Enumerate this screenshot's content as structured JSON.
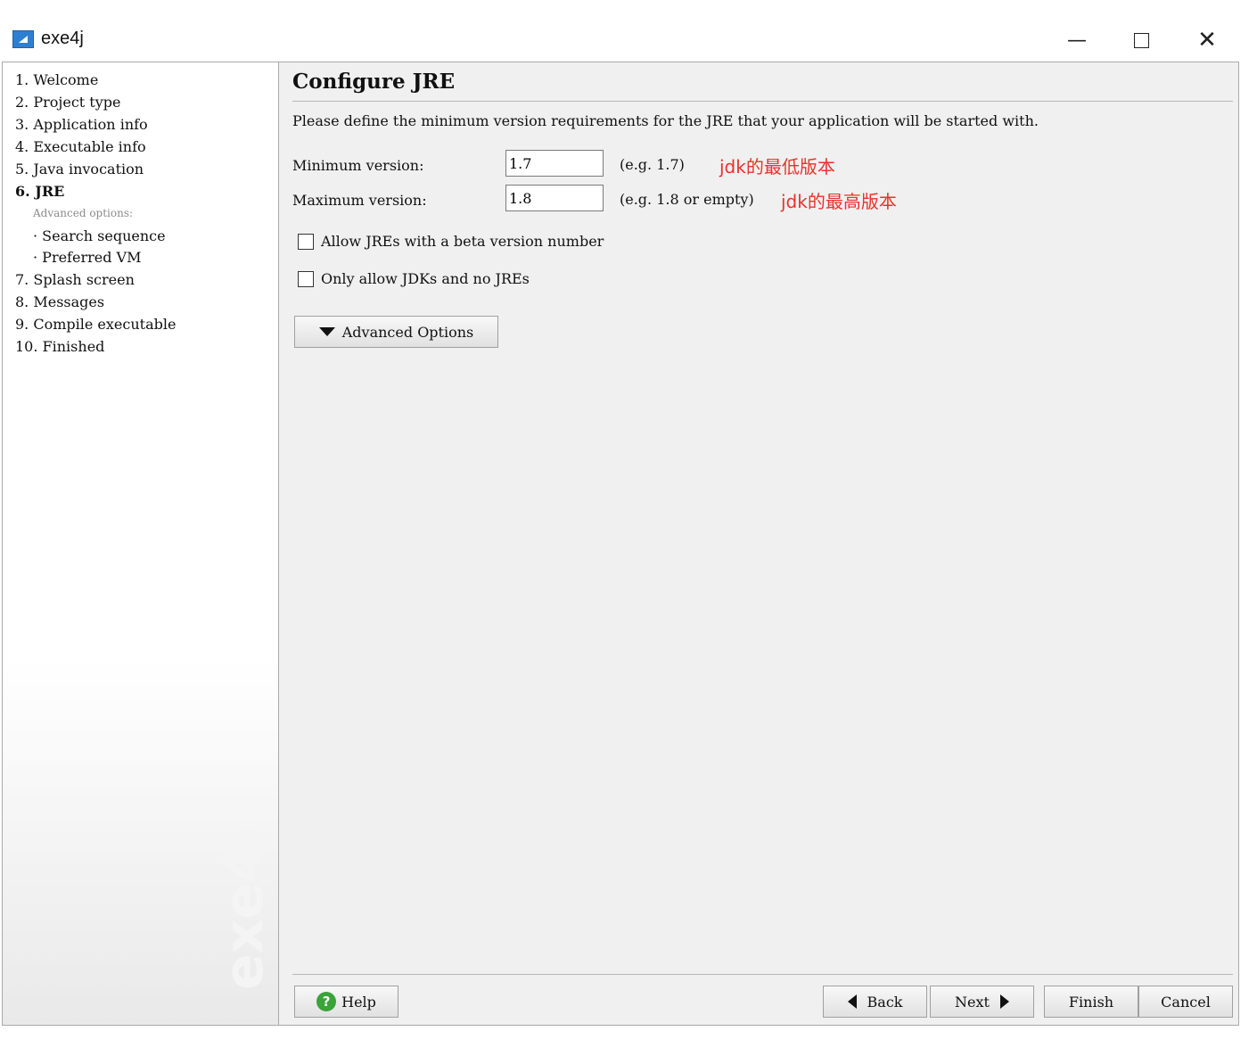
{
  "window": {
    "title": "exe4j",
    "icon": "exe4j-app-icon"
  },
  "sidebar": {
    "steps": [
      {
        "label": "1.  Welcome"
      },
      {
        "label": "2.  Project type"
      },
      {
        "label": "3.  Application info"
      },
      {
        "label": "4.  Executable info"
      },
      {
        "label": "5.  Java invocation"
      },
      {
        "label": "6.  JRE",
        "active": true
      },
      {
        "label": "7.  Splash screen"
      },
      {
        "label": "8.  Messages"
      },
      {
        "label": "9.  Compile executable"
      },
      {
        "label": "10.  Finished"
      }
    ],
    "advanced_label": "Advanced options:",
    "sub_steps": [
      {
        "label": "· Search sequence"
      },
      {
        "label": "· Preferred VM"
      }
    ],
    "watermark": "exe4j"
  },
  "main": {
    "heading": "Configure JRE",
    "description": "Please define the minimum version requirements for the JRE that your application will be started with.",
    "min_version": {
      "label": "Minimum version:",
      "value": "1.7",
      "hint": "(e.g. 1.7)",
      "note": "jdk的最低版本"
    },
    "max_version": {
      "label": "Maximum version:",
      "value": "1.8",
      "hint": "(e.g. 1.8 or empty)",
      "note": "jdk的最高版本"
    },
    "checkboxes": [
      {
        "label": "Allow JREs with a beta version number",
        "checked": false
      },
      {
        "label": "Only allow JDKs and no JREs",
        "checked": false
      }
    ],
    "advanced_button": "Advanced Options"
  },
  "footer": {
    "help": "Help",
    "back": "Back",
    "next": "Next",
    "finish": "Finish",
    "cancel": "Cancel"
  },
  "colors": {
    "annotation": "#e8332b",
    "help_icon": "#3aa33a",
    "app_icon": "#2f7fd1"
  }
}
